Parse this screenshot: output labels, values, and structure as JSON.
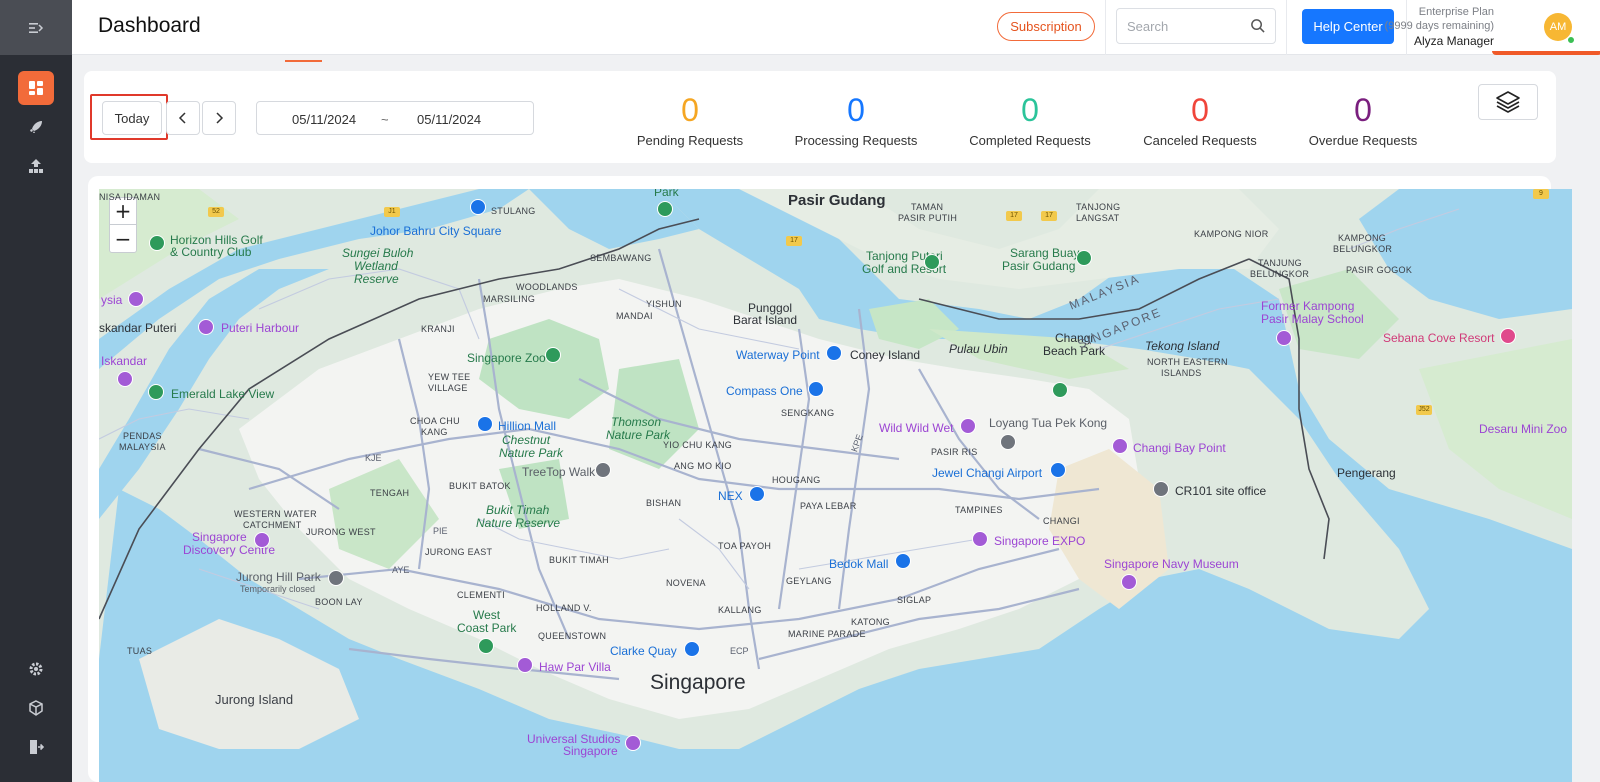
{
  "app": {
    "title": "Dashboard"
  },
  "sidebar": {
    "top_icon": "collapse-menu-icon",
    "items": [
      {
        "icon": "dashboard-grid-icon",
        "active": true
      },
      {
        "icon": "rocket-icon",
        "active": false
      },
      {
        "icon": "network-tree-icon",
        "active": false
      }
    ],
    "bottom_items": [
      {
        "icon": "gear-icon"
      },
      {
        "icon": "cube-icon"
      },
      {
        "icon": "logout-icon"
      }
    ]
  },
  "header": {
    "subscription_label": "Subscription",
    "search_placeholder": "Search",
    "help_label": "Help Center",
    "plan_name": "Enterprise Plan",
    "plan_days": "(9999 days remaining)",
    "user_name": "Alyza Manager",
    "avatar_initials": "AM"
  },
  "toolbar": {
    "today_label": "Today",
    "date_from": "05/11/2024",
    "date_separator": "~",
    "date_to": "05/11/2024"
  },
  "stats": [
    {
      "value": "0",
      "label": "Pending Requests",
      "color": "#f5a623"
    },
    {
      "value": "0",
      "label": "Processing Requests",
      "color": "#1677ff"
    },
    {
      "value": "0",
      "label": "Completed Requests",
      "color": "#2bc49a"
    },
    {
      "value": "0",
      "label": "Canceled Requests",
      "color": "#f0453a"
    },
    {
      "value": "0",
      "label": "Overdue Requests",
      "color": "#7a1f7e"
    }
  ],
  "map": {
    "zoom_in": "+",
    "zoom_out": "−",
    "labels": {
      "singapore": "Singapore",
      "pasir_gudang": "Pasir Gudang",
      "johor_bahru": "Johor Bahru City Square",
      "horizon_hills_1": "Horizon Hills Golf",
      "horizon_hills_2": "& Country Club",
      "sungei_buloh_1": "Sungei Buloh",
      "sungei_buloh_2": "Wetland",
      "sungei_buloh_3": "Reserve",
      "iskandar_puteri": "skandar Puteri",
      "puteri_harbour": "Puteri Harbour",
      "iskandar": "Iskandar",
      "emerald_lake": "Emerald Lake View",
      "ysia": "ysia",
      "singapore_zoo": "Singapore Zoo",
      "hillion_mall": "Hillion Mall",
      "chestnut_1": "Chestnut",
      "chestnut_2": "Nature Park",
      "treetop": "TreeTop Walk",
      "thomson_1": "Thomson",
      "thomson_2": "Nature Park",
      "bukit_timah_1": "Bukit Timah",
      "bukit_timah_2": "Nature Reserve",
      "sg_discovery_1": "Singapore",
      "sg_discovery_2": "Discovery Centre",
      "jurong_hill_1": "Jurong Hill Park",
      "jurong_hill_2": "Temporarily closed",
      "west_coast_1": "West",
      "west_coast_2": "Coast Park",
      "haw_par": "Haw Par Villa",
      "clarke_quay": "Clarke Quay",
      "universal_1": "Universal Studios",
      "universal_2": "Singapore",
      "jurong_island": "Jurong Island",
      "punggol_1": "Punggol",
      "punggol_2": "Barat Island",
      "waterway": "Waterway Point",
      "coney": "Coney Island",
      "compass": "Compass One",
      "pulau_ubin": "Pulau Ubin",
      "changi_beach_1": "Changi",
      "changi_beach_2": "Beach Park",
      "wild_wild_wet": "Wild Wild Wet",
      "loyang": "Loyang Tua Pek Kong",
      "jewel": "Jewel Changi Airport",
      "changi_bay": "Changi Bay Point",
      "cr101": "CR101 site office",
      "nex": "NEX",
      "bedok_mall": "Bedok Mall",
      "sg_expo": "Singapore EXPO",
      "navy_museum": "Singapore Navy Museum",
      "tanjong_puteri_1": "Tanjong Puteri",
      "tanjong_puteri_2": "Golf and Resort",
      "sarang_buaya_1": "Sarang Buaya",
      "sarang_buaya_2": "Pasir Gudang",
      "former_kampong_1": "Former Kampong",
      "former_kampong_2": "Pasir Malay School",
      "sebana": "Sebana Cove Resort",
      "tekong": "Tekong Island",
      "desaru": "Desaru Mini Zoo",
      "pengerang": "Pengerang",
      "malaysia": "MALAYSIA",
      "singapore_country": "SINGAPORE",
      "park": "Park",
      "stulang": "STULANG",
      "sembawang": "SEMBAWANG",
      "woodlands": "WOODLANDS",
      "marsiling": "MARSILING",
      "yishun": "YISHUN",
      "mandai": "MANDAI",
      "kranji": "KRANJI",
      "yew_tee_1": "YEW TEE",
      "yew_tee_2": "VILLAGE",
      "choa_chu_kang_1": "CHOA CHU",
      "choa_chu_kang_2": "KANG",
      "yio_chu_kang": "YIO CHU KANG",
      "ang_mo_kio": "ANG MO KIO",
      "sengkang": "SENGKANG",
      "hougang": "HOUGANG",
      "bishan": "BISHAN",
      "paya_lebar": "PAYA LEBAR",
      "pasir_ris": "PASIR RIS",
      "tampines": "TAMPINES",
      "changi": "CHANGI",
      "tengah": "TENGAH",
      "bukit_batok": "BUKIT BATOK",
      "jurong_west": "JURONG WEST",
      "jurong_east": "JURONG EAST",
      "boon_lay": "BOON LAY",
      "clementi": "CLEMENTI",
      "bukit_timah": "BUKIT TIMAH",
      "toa_payoh": "TOA PAYOH",
      "novena": "NOVENA",
      "geylang": "GEYLANG",
      "kallang": "KALLANG",
      "katong": "KATONG",
      "siglap": "SIGLAP",
      "marine_parade": "MARINE PARADE",
      "holland": "HOLLAND V.",
      "queenstown": "QUEENSTOWN",
      "tuas": "TUAS",
      "western_water_1": "WESTERN WATER",
      "western_water_2": "CATCHMENT",
      "pendas_1": "PENDAS",
      "pendas_2": "MALAYSIA",
      "tanjong_1": "TANJONG",
      "tanjong_2": "LANGSAT",
      "taman_1": "TAMAN",
      "taman_2": "PASIR PUTIH",
      "kampong_nior": "KAMPONG NIOR",
      "kampong_belungkor_1": "KAMPONG",
      "kampong_belungkor_2": "BELUNGKOR",
      "tanjung_belungkor_1": "TANJUNG",
      "tanjung_belungkor_2": "BELUNGKOR",
      "pasir_gogok": "PASIR GOGOK",
      "ne_islands_1": "NORTH EASTERN",
      "ne_islands_2": "ISLANDS",
      "nisa_idaman": "NISA IDAMAN",
      "road_kje": "KJE",
      "road_pie": "PIE",
      "road_aye": "AYE",
      "road_kpe": "KPE",
      "road_ecp": "ECP",
      "shield_j1": "J1",
      "shield_17a": "17",
      "shield_17b": "17",
      "shield_17c": "17",
      "shield_52": "52",
      "shield_j52": "J52",
      "shield_9": "9"
    }
  }
}
